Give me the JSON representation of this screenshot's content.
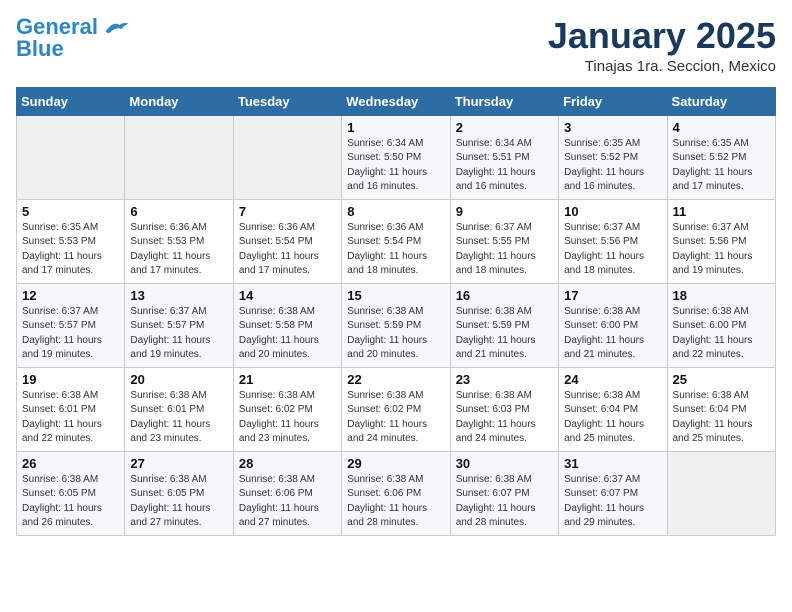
{
  "header": {
    "logo_line1": "General",
    "logo_line2": "Blue",
    "title": "January 2025",
    "subtitle": "Tinajas 1ra. Seccion, Mexico"
  },
  "days_of_week": [
    "Sunday",
    "Monday",
    "Tuesday",
    "Wednesday",
    "Thursday",
    "Friday",
    "Saturday"
  ],
  "weeks": [
    [
      {
        "day": "",
        "info": ""
      },
      {
        "day": "",
        "info": ""
      },
      {
        "day": "",
        "info": ""
      },
      {
        "day": "1",
        "info": "Sunrise: 6:34 AM\nSunset: 5:50 PM\nDaylight: 11 hours\nand 16 minutes."
      },
      {
        "day": "2",
        "info": "Sunrise: 6:34 AM\nSunset: 5:51 PM\nDaylight: 11 hours\nand 16 minutes."
      },
      {
        "day": "3",
        "info": "Sunrise: 6:35 AM\nSunset: 5:52 PM\nDaylight: 11 hours\nand 16 minutes."
      },
      {
        "day": "4",
        "info": "Sunrise: 6:35 AM\nSunset: 5:52 PM\nDaylight: 11 hours\nand 17 minutes."
      }
    ],
    [
      {
        "day": "5",
        "info": "Sunrise: 6:35 AM\nSunset: 5:53 PM\nDaylight: 11 hours\nand 17 minutes."
      },
      {
        "day": "6",
        "info": "Sunrise: 6:36 AM\nSunset: 5:53 PM\nDaylight: 11 hours\nand 17 minutes."
      },
      {
        "day": "7",
        "info": "Sunrise: 6:36 AM\nSunset: 5:54 PM\nDaylight: 11 hours\nand 17 minutes."
      },
      {
        "day": "8",
        "info": "Sunrise: 6:36 AM\nSunset: 5:54 PM\nDaylight: 11 hours\nand 18 minutes."
      },
      {
        "day": "9",
        "info": "Sunrise: 6:37 AM\nSunset: 5:55 PM\nDaylight: 11 hours\nand 18 minutes."
      },
      {
        "day": "10",
        "info": "Sunrise: 6:37 AM\nSunset: 5:56 PM\nDaylight: 11 hours\nand 18 minutes."
      },
      {
        "day": "11",
        "info": "Sunrise: 6:37 AM\nSunset: 5:56 PM\nDaylight: 11 hours\nand 19 minutes."
      }
    ],
    [
      {
        "day": "12",
        "info": "Sunrise: 6:37 AM\nSunset: 5:57 PM\nDaylight: 11 hours\nand 19 minutes."
      },
      {
        "day": "13",
        "info": "Sunrise: 6:37 AM\nSunset: 5:57 PM\nDaylight: 11 hours\nand 19 minutes."
      },
      {
        "day": "14",
        "info": "Sunrise: 6:38 AM\nSunset: 5:58 PM\nDaylight: 11 hours\nand 20 minutes."
      },
      {
        "day": "15",
        "info": "Sunrise: 6:38 AM\nSunset: 5:59 PM\nDaylight: 11 hours\nand 20 minutes."
      },
      {
        "day": "16",
        "info": "Sunrise: 6:38 AM\nSunset: 5:59 PM\nDaylight: 11 hours\nand 21 minutes."
      },
      {
        "day": "17",
        "info": "Sunrise: 6:38 AM\nSunset: 6:00 PM\nDaylight: 11 hours\nand 21 minutes."
      },
      {
        "day": "18",
        "info": "Sunrise: 6:38 AM\nSunset: 6:00 PM\nDaylight: 11 hours\nand 22 minutes."
      }
    ],
    [
      {
        "day": "19",
        "info": "Sunrise: 6:38 AM\nSunset: 6:01 PM\nDaylight: 11 hours\nand 22 minutes."
      },
      {
        "day": "20",
        "info": "Sunrise: 6:38 AM\nSunset: 6:01 PM\nDaylight: 11 hours\nand 23 minutes."
      },
      {
        "day": "21",
        "info": "Sunrise: 6:38 AM\nSunset: 6:02 PM\nDaylight: 11 hours\nand 23 minutes."
      },
      {
        "day": "22",
        "info": "Sunrise: 6:38 AM\nSunset: 6:02 PM\nDaylight: 11 hours\nand 24 minutes."
      },
      {
        "day": "23",
        "info": "Sunrise: 6:38 AM\nSunset: 6:03 PM\nDaylight: 11 hours\nand 24 minutes."
      },
      {
        "day": "24",
        "info": "Sunrise: 6:38 AM\nSunset: 6:04 PM\nDaylight: 11 hours\nand 25 minutes."
      },
      {
        "day": "25",
        "info": "Sunrise: 6:38 AM\nSunset: 6:04 PM\nDaylight: 11 hours\nand 25 minutes."
      }
    ],
    [
      {
        "day": "26",
        "info": "Sunrise: 6:38 AM\nSunset: 6:05 PM\nDaylight: 11 hours\nand 26 minutes."
      },
      {
        "day": "27",
        "info": "Sunrise: 6:38 AM\nSunset: 6:05 PM\nDaylight: 11 hours\nand 27 minutes."
      },
      {
        "day": "28",
        "info": "Sunrise: 6:38 AM\nSunset: 6:06 PM\nDaylight: 11 hours\nand 27 minutes."
      },
      {
        "day": "29",
        "info": "Sunrise: 6:38 AM\nSunset: 6:06 PM\nDaylight: 11 hours\nand 28 minutes."
      },
      {
        "day": "30",
        "info": "Sunrise: 6:38 AM\nSunset: 6:07 PM\nDaylight: 11 hours\nand 28 minutes."
      },
      {
        "day": "31",
        "info": "Sunrise: 6:37 AM\nSunset: 6:07 PM\nDaylight: 11 hours\nand 29 minutes."
      },
      {
        "day": "",
        "info": ""
      }
    ]
  ]
}
